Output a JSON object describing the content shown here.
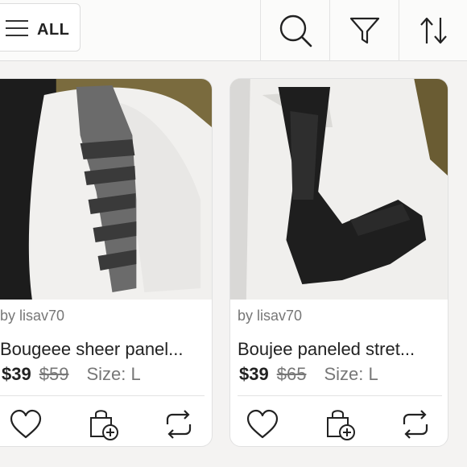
{
  "toolbar": {
    "all_label": "ALL",
    "icons": [
      "hamburger-icon",
      "search-icon",
      "filter-icon",
      "sort-icon"
    ]
  },
  "listings": [
    {
      "seller": "by lisav70",
      "title": "Bougeee sheer panel...",
      "price": "$39",
      "original_price": "$59",
      "size": "Size: L"
    },
    {
      "seller": "by lisav70",
      "title": "Boujee paneled stret...",
      "price": "$39",
      "original_price": "$65",
      "size": "Size: L"
    }
  ],
  "actions": [
    "like-icon",
    "add-to-bundle-icon",
    "share-icon"
  ],
  "colors": {
    "text": "#222222",
    "muted": "#777777",
    "border": "#e1e1e1"
  }
}
